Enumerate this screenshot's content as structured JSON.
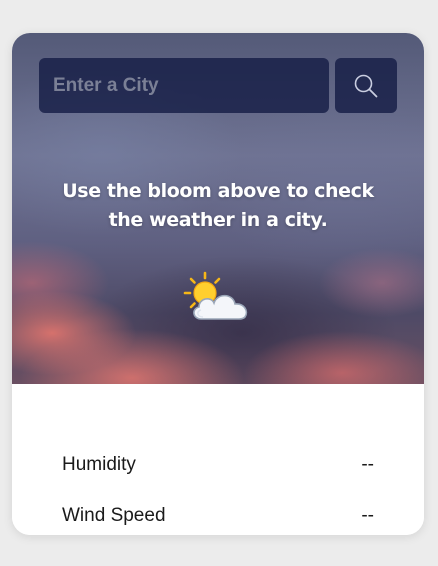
{
  "search": {
    "placeholder": "Enter a City",
    "value": "",
    "button_icon": "search-icon"
  },
  "message": {
    "line1": "Use the bloom above to check",
    "line2": "the weather in a city."
  },
  "weather_icon": "partly-sunny-icon",
  "details": [
    {
      "label": "Humidity",
      "value": "--"
    },
    {
      "label": "Wind Speed",
      "value": "--"
    }
  ],
  "colors": {
    "page_background": "#ececec",
    "input_background": "#121a42",
    "card_background": "#ffffff",
    "text_dark": "#1a1a1a"
  }
}
